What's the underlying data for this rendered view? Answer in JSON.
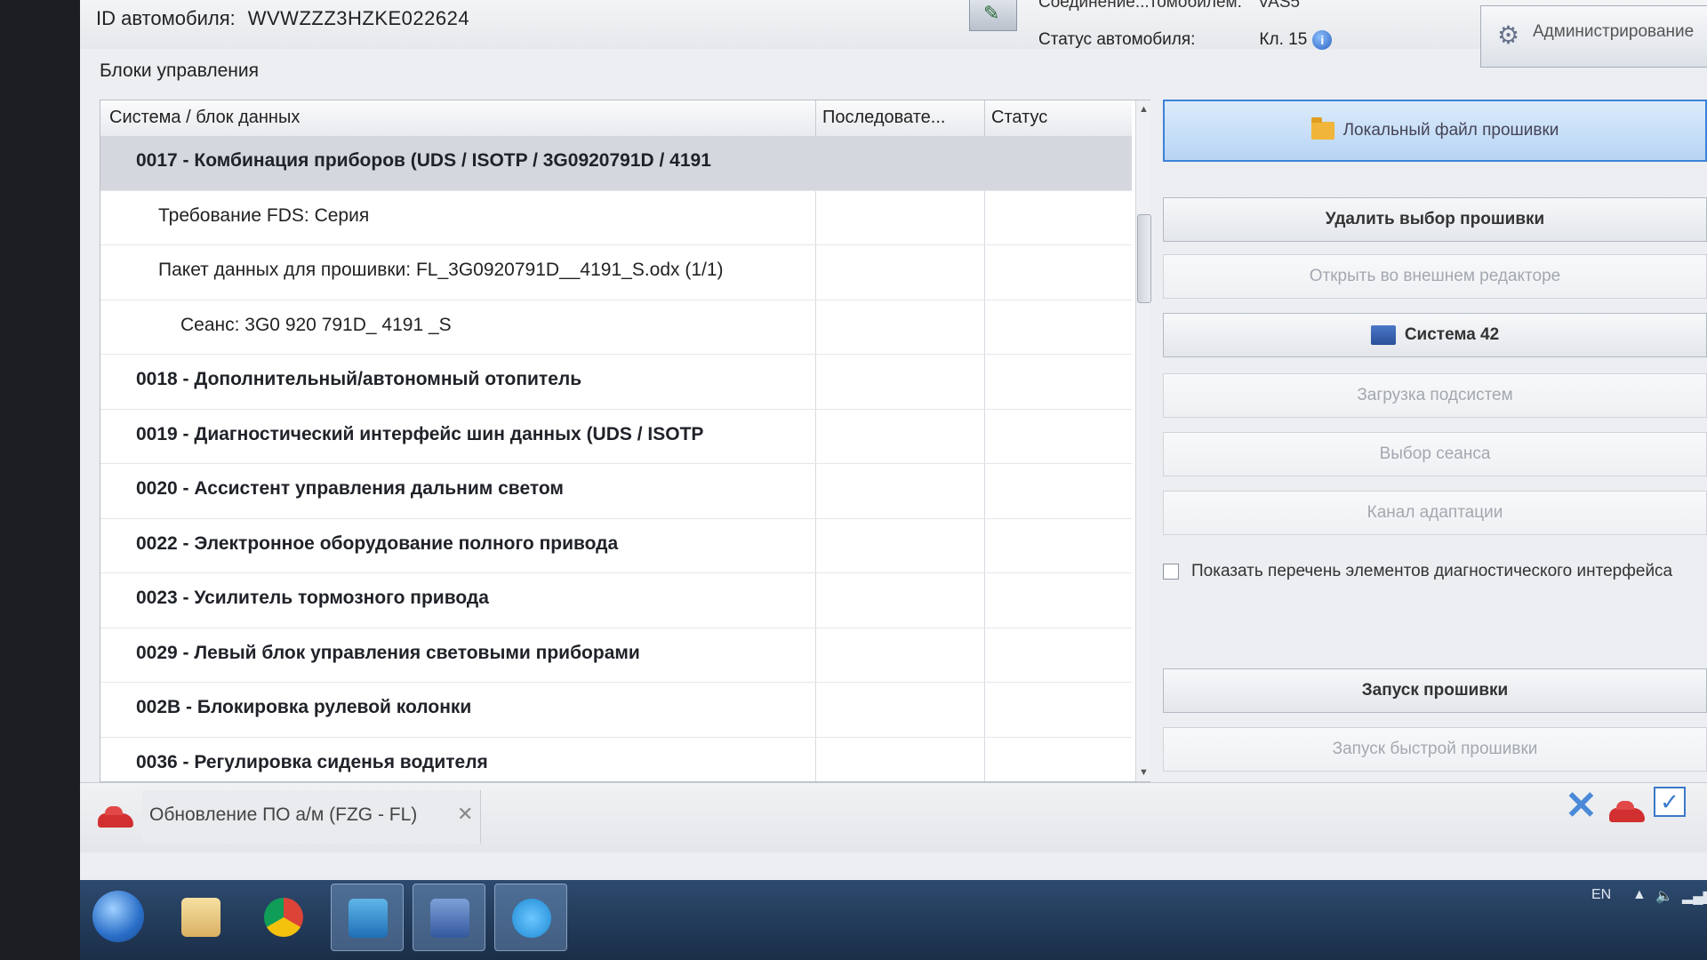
{
  "header": {
    "vehicle_id_label": "ID автомобиля:",
    "vehicle_id_value": "WVWZZZ3HZKE022624",
    "connection_label": "Соединение...томобилем:",
    "connection_value": "VAS5",
    "status_label": "Статус автомобиля:",
    "status_value": "Кл. 15",
    "admin_label": "Администрирование"
  },
  "section_title": "Блоки управления",
  "table": {
    "columns": [
      "Система / блок данных",
      "Последовате...",
      "Статус"
    ],
    "rows": [
      {
        "text": "0017 - Комбинация приборов  (UDS / ISOTP / 3G0920791D / 4191",
        "level": 0,
        "bold": true,
        "selected": true
      },
      {
        "text": "Требование FDS: Серия",
        "level": 1,
        "bold": false,
        "selected": false
      },
      {
        "text": "Пакет данных для прошивки: FL_3G0920791D__4191_S.odx (1/1)",
        "level": 1,
        "bold": false,
        "selected": false
      },
      {
        "text": "Сеанс: 3G0 920 791D_ 4191 _S",
        "level": 2,
        "bold": false,
        "selected": false
      },
      {
        "text": "0018 - Дополнительный/автономный отопитель",
        "level": 0,
        "bold": true,
        "selected": false
      },
      {
        "text": "0019 - Диагностический интерфейс шин данных  (UDS / ISOTP",
        "level": 0,
        "bold": true,
        "selected": false
      },
      {
        "text": "0020 - Ассистент управления дальним светом",
        "level": 0,
        "bold": true,
        "selected": false
      },
      {
        "text": "0022 - Электронное оборудование полного привода",
        "level": 0,
        "bold": true,
        "selected": false
      },
      {
        "text": "0023 - Усилитель тормозного привода",
        "level": 0,
        "bold": true,
        "selected": false
      },
      {
        "text": "0029 - Левый блок управления световыми приборами",
        "level": 0,
        "bold": true,
        "selected": false
      },
      {
        "text": "002B - Блокировка рулевой колонки",
        "level": 0,
        "bold": true,
        "selected": false
      },
      {
        "text": "0036 - Регулировка сиденья водителя",
        "level": 0,
        "bold": true,
        "selected": false
      }
    ]
  },
  "buttons": {
    "local_file": "Локальный файл прошивки",
    "delete_selection": "Удалить выбор прошивки",
    "open_external": "Открыть во внешнем редакторе",
    "system42": "Система 42",
    "load_subsystems": "Загрузка подсистем",
    "select_session": "Выбор сеанса",
    "adaptation_channel": "Канал адаптации",
    "start_flash": "Запуск прошивки",
    "start_quick_flash": "Запуск быстрой прошивки"
  },
  "checkbox": {
    "label": "Показать перечень элементов диагностического интерфейса",
    "checked": false
  },
  "bottom_tab": {
    "label": "Обновление ПО а/м (FZG - FL)"
  },
  "tray": {
    "language": "EN"
  },
  "colors": {
    "accent": "#3c82d8",
    "selected_row": "#d4d8de",
    "taskbar": "#22405f"
  }
}
